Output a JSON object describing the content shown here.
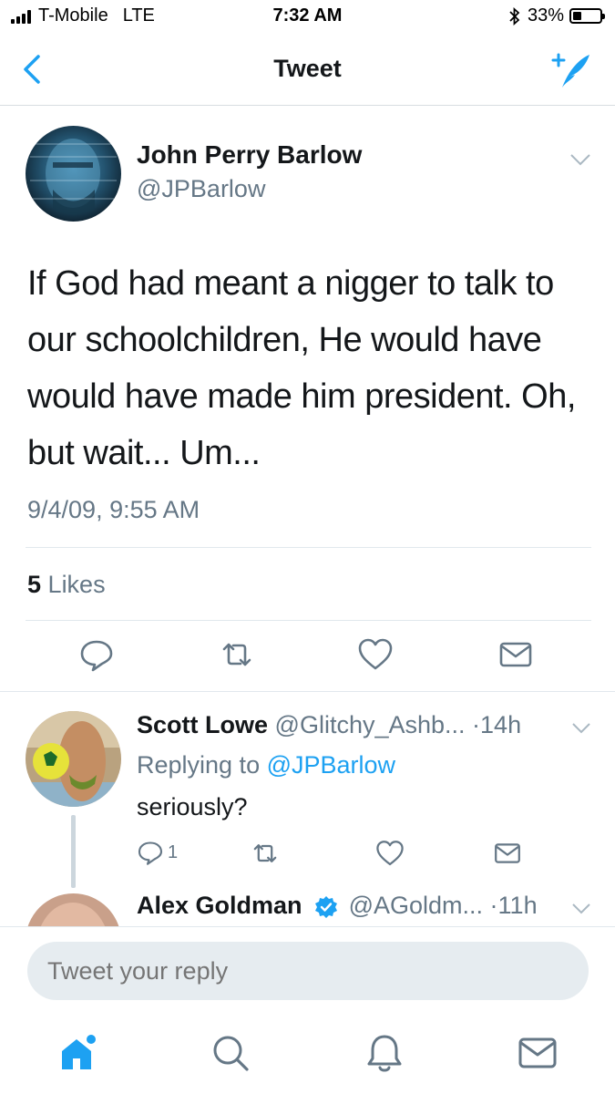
{
  "status_bar": {
    "carrier": "T-Mobile",
    "network": "LTE",
    "time": "7:32 AM",
    "battery": "33%",
    "battery_level": 0.33
  },
  "nav": {
    "title": "Tweet",
    "back_icon": "chevron-left-icon",
    "compose_icon": "compose-tweet-icon"
  },
  "tweet": {
    "author_name": "John Perry Barlow",
    "author_handle": "@JPBarlow",
    "text": "If God had meant a nigger to talk to our schoolchildren, He would have would have made him president. Oh, but wait... Um...",
    "date": "9/4/09, 9:55 AM",
    "likes_count": "5",
    "likes_label": "Likes"
  },
  "replies": [
    {
      "name": "Scott Lowe",
      "handle": "@Glitchy_Ashb...",
      "time": "·14h",
      "replying_label": "Replying to",
      "replying_to": "@JPBarlow",
      "text": "seriously?",
      "reply_count": "1"
    },
    {
      "name": "Alex Goldman",
      "handle": "@AGoldm...",
      "time": "·11h",
      "verified": true
    }
  ],
  "composer": {
    "placeholder": "Tweet your reply"
  },
  "tab_bar": {
    "items": [
      "home-icon",
      "search-icon",
      "notifications-icon",
      "messages-icon"
    ]
  },
  "colors": {
    "accent": "#1da1f2",
    "text": "#14171a",
    "secondary": "#657786",
    "divider": "#e1e8ed"
  }
}
